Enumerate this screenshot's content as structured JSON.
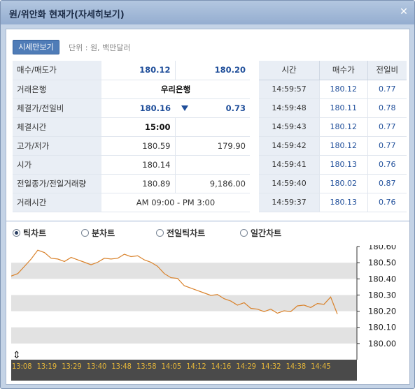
{
  "window": {
    "title": "원/위안화 현재가(자세히보기)",
    "close_icon": "close-icon"
  },
  "toolbar": {
    "summary_button": "시세만보기",
    "unit_text": "단위 : 원, 백만달러"
  },
  "info": {
    "bid_ask": {
      "label": "매수/매도가",
      "bid": "180.12",
      "ask": "180.20"
    },
    "bank": {
      "label": "거래은행",
      "value": "우리은행"
    },
    "last_change": {
      "label": "체결가/전일비",
      "price": "180.16",
      "change": "0.73",
      "direction": "down"
    },
    "trade_time": {
      "label": "체결시간",
      "value": "15:00"
    },
    "high_low": {
      "label": "고가/저가",
      "high": "180.59",
      "low": "179.90"
    },
    "open": {
      "label": "시가",
      "value": "180.14"
    },
    "prev_close_volume": {
      "label": "전일종가/전일거래량",
      "close": "180.89",
      "volume": "9,186.00"
    },
    "hours": {
      "label": "거래시간",
      "value": "AM 09:00 - PM 3:00"
    }
  },
  "trades": {
    "headers": [
      "시간",
      "매수가",
      "전일비"
    ],
    "rows": [
      {
        "time": "14:59:57",
        "price": "180.12",
        "change": "0.77"
      },
      {
        "time": "14:59:48",
        "price": "180.11",
        "change": "0.78"
      },
      {
        "time": "14:59:43",
        "price": "180.12",
        "change": "0.77"
      },
      {
        "time": "14:59:42",
        "price": "180.12",
        "change": "0.77"
      },
      {
        "time": "14:59:41",
        "price": "180.13",
        "change": "0.76"
      },
      {
        "time": "14:59:40",
        "price": "180.02",
        "change": "0.87"
      },
      {
        "time": "14:59:37",
        "price": "180.13",
        "change": "0.76"
      }
    ]
  },
  "chart_tabs": [
    {
      "label": "틱차트",
      "selected": true
    },
    {
      "label": "분차트",
      "selected": false
    },
    {
      "label": "전일틱차트",
      "selected": false
    },
    {
      "label": "일간차트",
      "selected": false
    }
  ],
  "chart_data": {
    "type": "line",
    "y_ticks": [
      "180.60",
      "180.50",
      "180.40",
      "180.30",
      "180.20",
      "180.10",
      "180.00"
    ],
    "ylim": [
      179.9,
      180.6
    ],
    "x_ticks": [
      "13:08",
      "13:19",
      "13:29",
      "13:40",
      "13:48",
      "13:58",
      "14:05",
      "14:12",
      "14:16",
      "14:29",
      "14:32",
      "14:38",
      "14:45"
    ],
    "series": [
      {
        "color": "#d9822b",
        "values": [
          180.42,
          180.43,
          180.48,
          180.52,
          180.58,
          180.56,
          180.53,
          180.52,
          180.51,
          180.53,
          180.52,
          180.5,
          180.49,
          180.5,
          180.53,
          180.52,
          180.53,
          180.55,
          180.54,
          180.54,
          180.52,
          180.5,
          180.48,
          180.43,
          180.41,
          180.4,
          180.36,
          180.34,
          180.33,
          180.31,
          180.3,
          180.3,
          180.28,
          180.26,
          180.24,
          180.25,
          180.22,
          180.21,
          180.2,
          180.21,
          180.19,
          180.2,
          180.2,
          180.23,
          180.24,
          180.22,
          180.25,
          180.24,
          180.29,
          180.18
        ]
      }
    ],
    "colors": {
      "band": "#e2e2e2",
      "axis": "#333333",
      "tick_text": "#e5b63a",
      "x_axis_bg": "#4a4a4a"
    }
  }
}
